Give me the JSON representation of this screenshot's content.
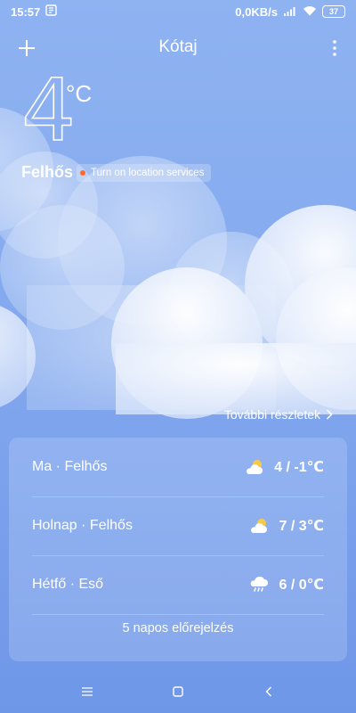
{
  "status_bar": {
    "time": "15:57",
    "network_speed": "0,0KB/s",
    "battery": "37"
  },
  "header": {
    "city": "Kótaj"
  },
  "current": {
    "temperature": "4",
    "unit": "°C",
    "condition": "Felhős",
    "location_prompt": "Turn on location services"
  },
  "details_link": "További részletek",
  "forecast": {
    "rows": [
      {
        "day": "Ma · Felhős",
        "temps": "4 / -1℃",
        "icon": "partly-cloudy-icon"
      },
      {
        "day": "Holnap · Felhős",
        "temps": "7 / 3℃",
        "icon": "partly-cloudy-icon"
      },
      {
        "day": "Hétfő · Eső",
        "temps": "6 / 0℃",
        "icon": "rain-icon"
      }
    ],
    "button_label": "5 napos előrejelzés"
  },
  "colors": {
    "background_top": "#8fb3f1",
    "background_bottom": "#6f97e8",
    "location_dot": "#ff6a2a",
    "sun": "#f7c948"
  }
}
